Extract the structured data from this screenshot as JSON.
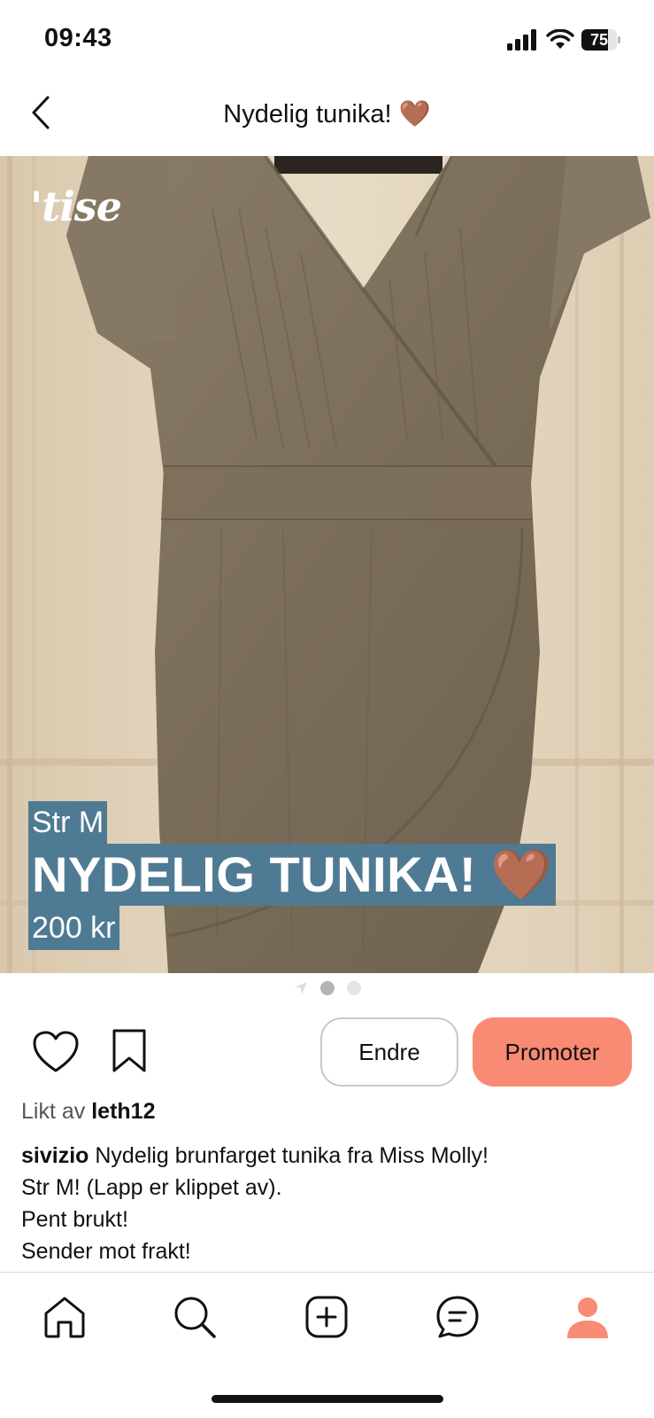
{
  "status_bar": {
    "time": "09:43",
    "battery_level": "75",
    "battery_fraction": 0.75
  },
  "header": {
    "title": "Nydelig tunika! 🤎",
    "back_icon": "chevron-left-icon"
  },
  "photo": {
    "watermark": "'tise",
    "overlay_size": "Str M",
    "overlay_title": "NYDELIG TUNIKA! 🤎",
    "overlay_price": "200 kr",
    "overlay_color": "#4f7a93",
    "page_count": 2,
    "current_page": 1
  },
  "actions": {
    "like_icon": "heart-icon",
    "save_icon": "bookmark-icon",
    "edit_label": "Endre",
    "promote_label": "Promoter",
    "promote_color": "#f98a73"
  },
  "liked_by": {
    "prefix": "Likt av",
    "user": "leth12"
  },
  "description": {
    "username": "sivizio",
    "lines": [
      "Nydelig brunfarget tunika fra Miss Molly!",
      "Str M! (Lapp er klippet av).",
      "Pent brukt!",
      "Sender mot frakt!"
    ]
  },
  "tabbar": {
    "items": [
      {
        "icon": "home-icon"
      },
      {
        "icon": "search-icon"
      },
      {
        "icon": "add-icon"
      },
      {
        "icon": "messages-icon"
      },
      {
        "icon": "profile-icon",
        "active_color": "#f98a73"
      }
    ]
  }
}
